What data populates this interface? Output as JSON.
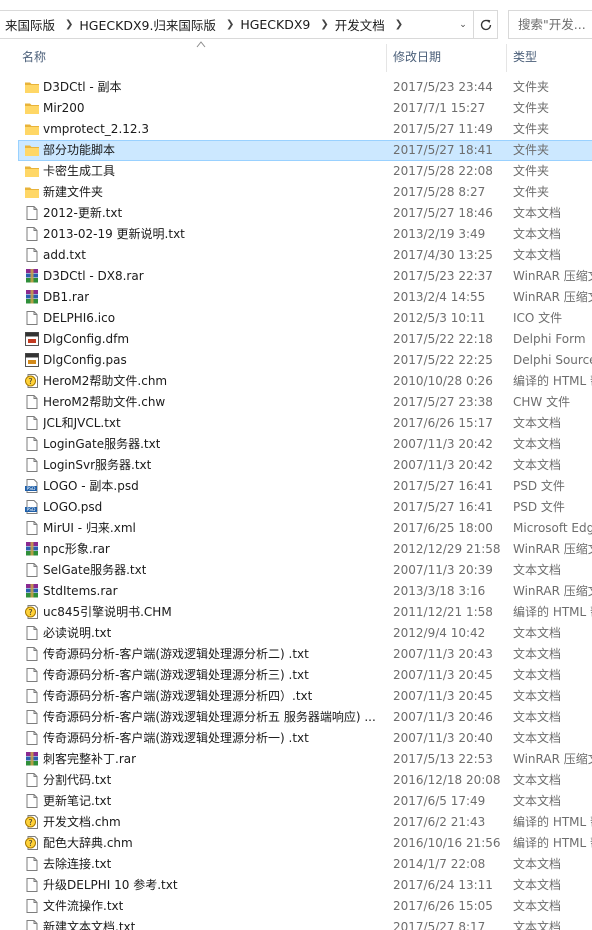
{
  "address": {
    "breadcrumbs": [
      "来国际版",
      "HGECKDX9.归来国际版",
      "HGECKDX9",
      "开发文档"
    ]
  },
  "search": {
    "placeholder": "搜索\"开发..."
  },
  "columns": {
    "name": "名称",
    "date": "修改日期",
    "type": "类型"
  },
  "files": [
    {
      "name": "D3DCtl - 副本",
      "date": "2017/5/23 23:44",
      "type": "文件夹",
      "icon": "folder-icon"
    },
    {
      "name": "Mir200",
      "date": "2017/7/1 15:27",
      "type": "文件夹",
      "icon": "folder-icon"
    },
    {
      "name": "vmprotect_2.12.3",
      "date": "2017/5/27 11:49",
      "type": "文件夹",
      "icon": "folder-icon"
    },
    {
      "name": "部分功能脚本",
      "date": "2017/5/27 18:41",
      "type": "文件夹",
      "icon": "folder-icon",
      "selected": true
    },
    {
      "name": "卡密生成工具",
      "date": "2017/5/28 22:08",
      "type": "文件夹",
      "icon": "folder-icon"
    },
    {
      "name": "新建文件夹",
      "date": "2017/5/28 8:27",
      "type": "文件夹",
      "icon": "folder-icon"
    },
    {
      "name": "2012-更新.txt",
      "date": "2017/5/27 18:46",
      "type": "文本文档",
      "icon": "text-file-icon"
    },
    {
      "name": "2013-02-19 更新说明.txt",
      "date": "2013/2/19 3:49",
      "type": "文本文档",
      "icon": "text-file-icon"
    },
    {
      "name": "add.txt",
      "date": "2017/4/30 13:25",
      "type": "文本文档",
      "icon": "text-file-icon"
    },
    {
      "name": "D3DCtl - DX8.rar",
      "date": "2017/5/23 22:37",
      "type": "WinRAR 压缩文",
      "icon": "rar-archive-icon"
    },
    {
      "name": "DB1.rar",
      "date": "2013/2/4 14:55",
      "type": "WinRAR 压缩文",
      "icon": "rar-archive-icon"
    },
    {
      "name": "DELPHI6.ico",
      "date": "2012/5/3 10:11",
      "type": "ICO 文件",
      "icon": "text-file-icon"
    },
    {
      "name": "DlgConfig.dfm",
      "date": "2017/5/22 22:18",
      "type": "Delphi Form",
      "icon": "delphi-form-icon"
    },
    {
      "name": "DlgConfig.pas",
      "date": "2017/5/22 22:25",
      "type": "Delphi Source",
      "icon": "delphi-source-icon"
    },
    {
      "name": "HeroM2帮助文件.chm",
      "date": "2010/10/28 0:26",
      "type": "编译的 HTML 帮",
      "icon": "chm-help-icon"
    },
    {
      "name": "HeroM2帮助文件.chw",
      "date": "2017/5/27 23:38",
      "type": "CHW 文件",
      "icon": "text-file-icon"
    },
    {
      "name": "JCL和JVCL.txt",
      "date": "2017/6/26 15:17",
      "type": "文本文档",
      "icon": "text-file-icon"
    },
    {
      "name": "LoginGate服务器.txt",
      "date": "2007/11/3 20:42",
      "type": "文本文档",
      "icon": "text-file-icon"
    },
    {
      "name": "LoginSvr服务器.txt",
      "date": "2007/11/3 20:42",
      "type": "文本文档",
      "icon": "text-file-icon"
    },
    {
      "name": "LOGO - 副本.psd",
      "date": "2017/5/27 16:41",
      "type": "PSD 文件",
      "icon": "psd-file-icon"
    },
    {
      "name": "LOGO.psd",
      "date": "2017/5/27 16:41",
      "type": "PSD 文件",
      "icon": "psd-file-icon"
    },
    {
      "name": "MirUI - 归来.xml",
      "date": "2017/6/25 18:00",
      "type": "Microsoft Edg",
      "icon": "text-file-icon"
    },
    {
      "name": "npc形象.rar",
      "date": "2012/12/29 21:58",
      "type": "WinRAR 压缩文",
      "icon": "rar-archive-icon"
    },
    {
      "name": "SelGate服务器.txt",
      "date": "2007/11/3 20:39",
      "type": "文本文档",
      "icon": "text-file-icon"
    },
    {
      "name": "StdItems.rar",
      "date": "2013/3/18 3:16",
      "type": "WinRAR 压缩文",
      "icon": "rar-archive-icon"
    },
    {
      "name": "uc845引擎说明书.CHM",
      "date": "2011/12/21 1:58",
      "type": "编译的 HTML 帮",
      "icon": "chm-help-icon"
    },
    {
      "name": "必读说明.txt",
      "date": "2012/9/4 10:42",
      "type": "文本文档",
      "icon": "text-file-icon"
    },
    {
      "name": "传奇源码分析-客户端(游戏逻辑处理源分析二) .txt",
      "date": "2007/11/3 20:43",
      "type": "文本文档",
      "icon": "text-file-icon"
    },
    {
      "name": "传奇源码分析-客户端(游戏逻辑处理源分析三) .txt",
      "date": "2007/11/3 20:45",
      "type": "文本文档",
      "icon": "text-file-icon"
    },
    {
      "name": "传奇源码分析-客户端(游戏逻辑处理源分析四）.txt",
      "date": "2007/11/3 20:45",
      "type": "文本文档",
      "icon": "text-file-icon"
    },
    {
      "name": "传奇源码分析-客户端(游戏逻辑处理源分析五 服务器端响应) ...",
      "date": "2007/11/3 20:46",
      "type": "文本文档",
      "icon": "text-file-icon"
    },
    {
      "name": "传奇源码分析-客户端(游戏逻辑处理源分析一) .txt",
      "date": "2007/11/3 20:40",
      "type": "文本文档",
      "icon": "text-file-icon"
    },
    {
      "name": "刺客完整补丁.rar",
      "date": "2017/5/13 22:53",
      "type": "WinRAR 压缩文",
      "icon": "rar-archive-icon"
    },
    {
      "name": "分割代码.txt",
      "date": "2016/12/18 20:08",
      "type": "文本文档",
      "icon": "text-file-icon"
    },
    {
      "name": "更新笔记.txt",
      "date": "2017/6/5 17:49",
      "type": "文本文档",
      "icon": "text-file-icon"
    },
    {
      "name": "开发文档.chm",
      "date": "2017/6/2 21:43",
      "type": "编译的 HTML 帮",
      "icon": "chm-help-icon"
    },
    {
      "name": "配色大辞典.chm",
      "date": "2016/10/16 21:56",
      "type": "编译的 HTML 帮",
      "icon": "chm-help-icon"
    },
    {
      "name": "去除连接.txt",
      "date": "2014/1/7 22:08",
      "type": "文本文档",
      "icon": "text-file-icon"
    },
    {
      "name": "升级DELPHI 10 参考.txt",
      "date": "2017/6/24 13:11",
      "type": "文本文档",
      "icon": "text-file-icon"
    },
    {
      "name": "文件流操作.txt",
      "date": "2017/6/26 15:05",
      "type": "文本文档",
      "icon": "text-file-icon"
    },
    {
      "name": "新建文本文档.txt",
      "date": "2017/5/27 8:17",
      "type": "文本文档",
      "icon": "text-file-icon"
    }
  ]
}
